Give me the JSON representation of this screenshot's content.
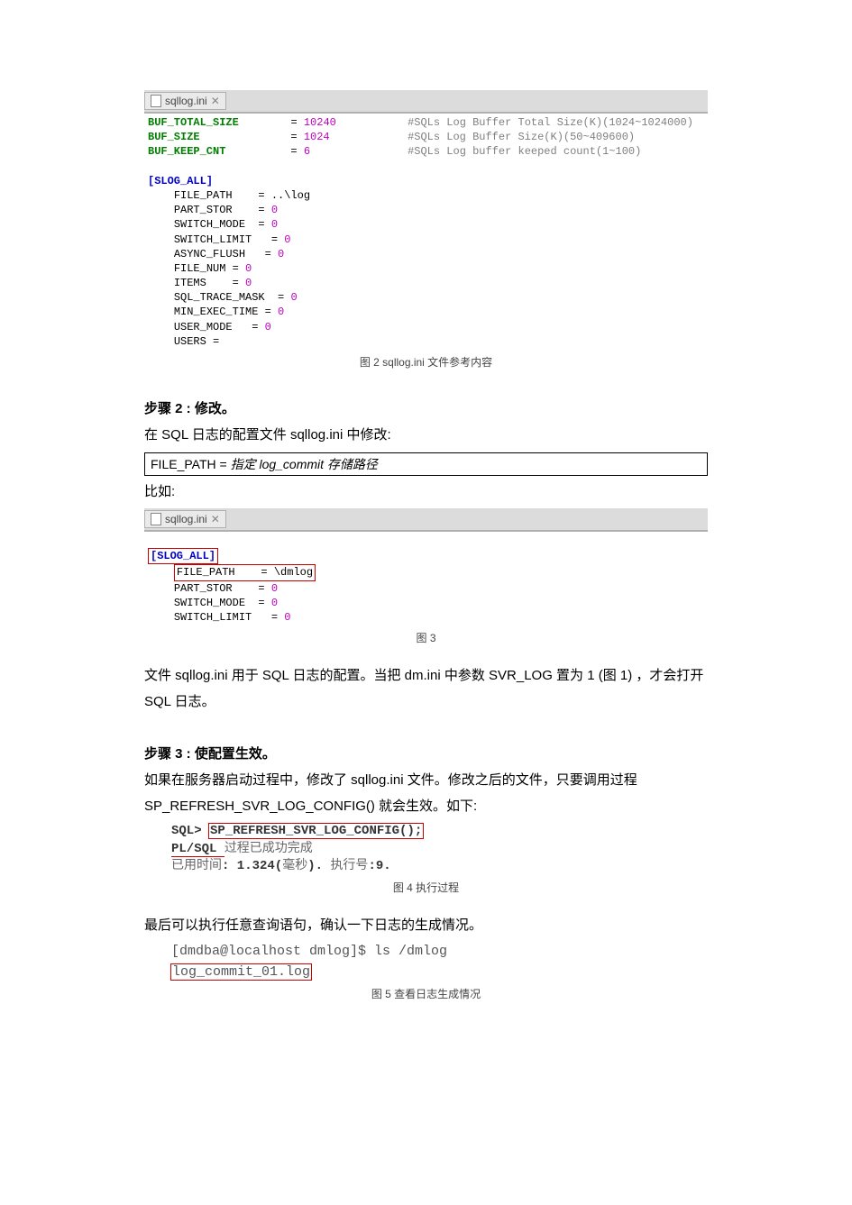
{
  "figure1": {
    "tab_name": "sqllog.ini",
    "lines": {
      "buf_total_size_key": "BUF_TOTAL_SIZE",
      "buf_total_size_val": "10240",
      "buf_total_size_cmt": "#SQLs Log Buffer Total Size(K)(1024~1024000)",
      "buf_size_key": "BUF_SIZE",
      "buf_size_val": "1024",
      "buf_size_cmt": "#SQLs Log Buffer Size(K)(50~409600)",
      "buf_keep_cnt_key": "BUF_KEEP_CNT",
      "buf_keep_cnt_val": "6",
      "buf_keep_cnt_cmt": "#SQLs Log buffer keeped count(1~100)",
      "section": "[SLOG_ALL]",
      "file_path": "FILE_PATH    = ..\\log",
      "part_stor_key": "PART_STOR    = ",
      "part_stor_val": "0",
      "switch_mode_key": "SWITCH_MODE  = ",
      "switch_mode_val": "0",
      "switch_limit_key": "SWITCH_LIMIT   = ",
      "switch_limit_val": "0",
      "async_flush_key": "ASYNC_FLUSH   = ",
      "async_flush_val": "0",
      "file_num_key": "FILE_NUM = ",
      "file_num_val": "0",
      "items_key": "ITEMS    = ",
      "items_val": "0",
      "sql_trace_mask_key": "SQL_TRACE_MASK  = ",
      "sql_trace_mask_val": "0",
      "min_exec_time_key": "MIN_EXEC_TIME = ",
      "min_exec_time_val": "0",
      "user_mode_key": "USER_MODE   = ",
      "user_mode_val": "0",
      "users": "USERS ="
    },
    "caption": "图 2 sqllog.ini 文件参考内容"
  },
  "step2": {
    "title": "步骤 2 : 修改。",
    "intro": "在 SQL 日志的配置文件 sqllog.ini 中修改:",
    "config_left": "FILE_PATH      = ",
    "config_right": "指定 log_commit 存储路径",
    "bijiao": "比如:"
  },
  "figure3": {
    "tab_name": "sqllog.ini",
    "section": "[SLOG_ALL]",
    "file_path_key": "FILE_PATH    = ",
    "file_path_val": "\\dmlog",
    "part_stor_key": "PART_STOR    = ",
    "part_stor_val": "0",
    "switch_mode_key": "SWITCH_MODE  = ",
    "switch_mode_val": "0",
    "switch_limit_key": "SWITCH_LIMIT   = ",
    "switch_limit_val": "0",
    "caption": "图 3"
  },
  "after_fig3": "文件 sqllog.ini 用于 SQL 日志的配置。当把 dm.ini 中参数 SVR_LOG 置为 1 (图 1) ，才会打开 SQL 日志。",
  "step3": {
    "title": "步骤 3 : 使配置生效。",
    "text": "如果在服务器启动过程中，修改了 sqllog.ini 文件。修改之后的文件，只要调用过程 SP_REFRESH_SVR_LOG_CONFIG()  就会生效。如下:"
  },
  "figure4": {
    "sql_prompt": "SQL> ",
    "sql_cmd": "SP_REFRESH_SVR_LOG_CONFIG();",
    "line2a": "PL/SQL ",
    "line2b": "过程已成功完成",
    "line3a": "已用时间",
    "line3b": ": 1.324(",
    "line3c": "毫秒",
    "line3d": "). ",
    "line3e": "执行号",
    "line3f": ":9.",
    "caption": "图 4 执行过程"
  },
  "after_fig4": "最后可以执行任意查询语句，确认一下日志的生成情况。",
  "figure5": {
    "line1": "[dmdba@localhost dmlog]$ ls /dmlog",
    "line2": "log_commit_01.log ",
    "caption": "图 5 查看日志生成情况"
  }
}
